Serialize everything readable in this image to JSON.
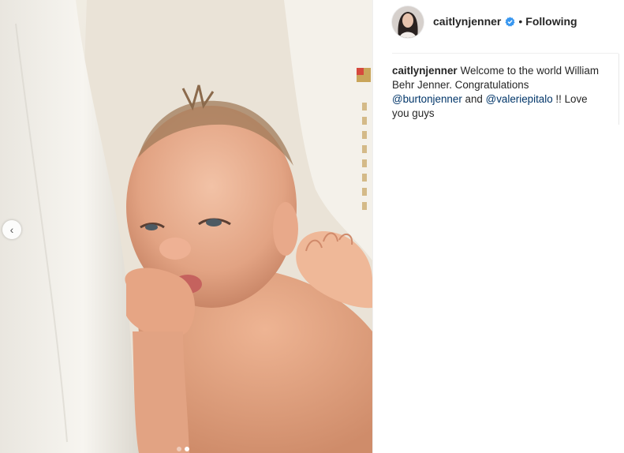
{
  "post": {
    "author": {
      "username": "caitlynjenner",
      "verified": true,
      "follow_status": "Following",
      "separator": "•"
    },
    "caption": {
      "username": "caitlynjenner",
      "text_before": "Welcome to the world William Behr Jenner. Congratulations",
      "mention_1": "@burtonjenner",
      "connector": "and",
      "mention_2": "@valeriepitalo",
      "text_after": "!! Love you guys"
    },
    "carousel": {
      "prev_icon": "chevron-left-icon",
      "prev_glyph": "‹",
      "slide_count": 2,
      "active_slide": 2
    }
  },
  "colors": {
    "verified_blue": "#3897f0",
    "mention": "#003569",
    "text": "#262626",
    "divider": "#efefef"
  }
}
